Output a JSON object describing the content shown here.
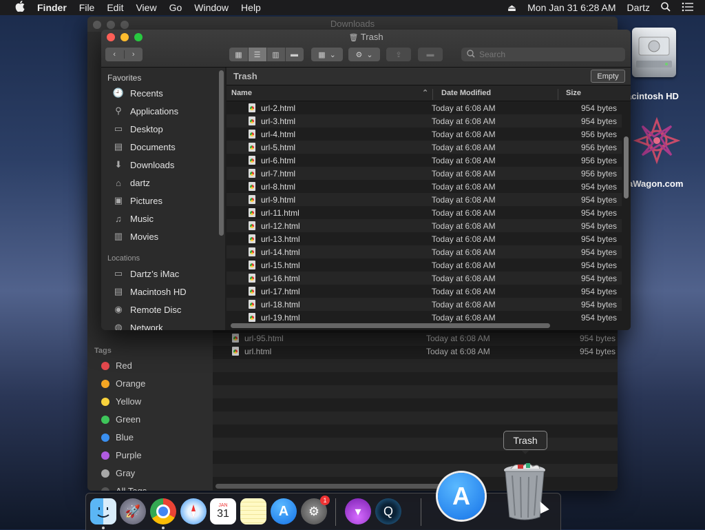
{
  "menubar": {
    "apple": "",
    "app": "Finder",
    "items": [
      "File",
      "Edit",
      "View",
      "Go",
      "Window",
      "Help"
    ],
    "clock": "Mon Jan 31  6:28 AM",
    "user": "Dartz"
  },
  "desktop": {
    "hd_label": "acintosh HD",
    "wagon_label": "aWagon.com"
  },
  "bg_window": {
    "title": "Downloads",
    "tags_title": "Tags",
    "tags": [
      {
        "label": "Red",
        "color": "#e5484d"
      },
      {
        "label": "Orange",
        "color": "#f5a623"
      },
      {
        "label": "Yellow",
        "color": "#f8d23c"
      },
      {
        "label": "Green",
        "color": "#3ec55a"
      },
      {
        "label": "Blue",
        "color": "#3a8ff0"
      },
      {
        "label": "Purple",
        "color": "#b05be0"
      },
      {
        "label": "Gray",
        "color": "#a8a8a8"
      },
      {
        "label": "All Tags...",
        "color": "#555555"
      }
    ],
    "rows": [
      {
        "name": "url-95.html",
        "date": "Today at 6:08 AM",
        "size": "954 bytes"
      },
      {
        "name": "url.html",
        "date": "Today at 6:08 AM",
        "size": "954 bytes"
      }
    ]
  },
  "window": {
    "title": "Trash",
    "search_placeholder": "Search",
    "path": "Trash",
    "empty_button": "Empty",
    "sidebar": {
      "favorites_title": "Favorites",
      "favorites": [
        {
          "label": "Recents",
          "icon": "clock-icon"
        },
        {
          "label": "Applications",
          "icon": "applications-icon"
        },
        {
          "label": "Desktop",
          "icon": "desktop-icon"
        },
        {
          "label": "Documents",
          "icon": "documents-icon"
        },
        {
          "label": "Downloads",
          "icon": "downloads-icon"
        },
        {
          "label": "dartz",
          "icon": "home-icon"
        },
        {
          "label": "Pictures",
          "icon": "camera-icon"
        },
        {
          "label": "Music",
          "icon": "music-icon"
        },
        {
          "label": "Movies",
          "icon": "movies-icon"
        }
      ],
      "locations_title": "Locations",
      "locations": [
        {
          "label": "Dartz’s iMac",
          "icon": "computer-icon"
        },
        {
          "label": "Macintosh HD",
          "icon": "disk-icon"
        },
        {
          "label": "Remote Disc",
          "icon": "disc-icon"
        },
        {
          "label": "Network",
          "icon": "network-icon"
        }
      ]
    },
    "columns": {
      "name": "Name",
      "date": "Date Modified",
      "size": "Size"
    },
    "files": [
      {
        "name": "url-2.html",
        "date": "Today at 6:08 AM",
        "size": "954 bytes"
      },
      {
        "name": "url-3.html",
        "date": "Today at 6:08 AM",
        "size": "954 bytes"
      },
      {
        "name": "url-4.html",
        "date": "Today at 6:08 AM",
        "size": "956 bytes"
      },
      {
        "name": "url-5.html",
        "date": "Today at 6:08 AM",
        "size": "956 bytes"
      },
      {
        "name": "url-6.html",
        "date": "Today at 6:08 AM",
        "size": "956 bytes"
      },
      {
        "name": "url-7.html",
        "date": "Today at 6:08 AM",
        "size": "956 bytes"
      },
      {
        "name": "url-8.html",
        "date": "Today at 6:08 AM",
        "size": "954 bytes"
      },
      {
        "name": "url-9.html",
        "date": "Today at 6:08 AM",
        "size": "954 bytes"
      },
      {
        "name": "url-11.html",
        "date": "Today at 6:08 AM",
        "size": "954 bytes"
      },
      {
        "name": "url-12.html",
        "date": "Today at 6:08 AM",
        "size": "954 bytes"
      },
      {
        "name": "url-13.html",
        "date": "Today at 6:08 AM",
        "size": "954 bytes"
      },
      {
        "name": "url-14.html",
        "date": "Today at 6:08 AM",
        "size": "954 bytes"
      },
      {
        "name": "url-15.html",
        "date": "Today at 6:08 AM",
        "size": "954 bytes"
      },
      {
        "name": "url-16.html",
        "date": "Today at 6:08 AM",
        "size": "954 bytes"
      },
      {
        "name": "url-17.html",
        "date": "Today at 6:08 AM",
        "size": "954 bytes"
      },
      {
        "name": "url-18.html",
        "date": "Today at 6:08 AM",
        "size": "954 bytes"
      },
      {
        "name": "url-19.html",
        "date": "Today at 6:08 AM",
        "size": "954 bytes"
      }
    ]
  },
  "tooltip": "Trash",
  "dock": {
    "badge": "1",
    "calendar_month": "JAN",
    "calendar_day": "31"
  }
}
